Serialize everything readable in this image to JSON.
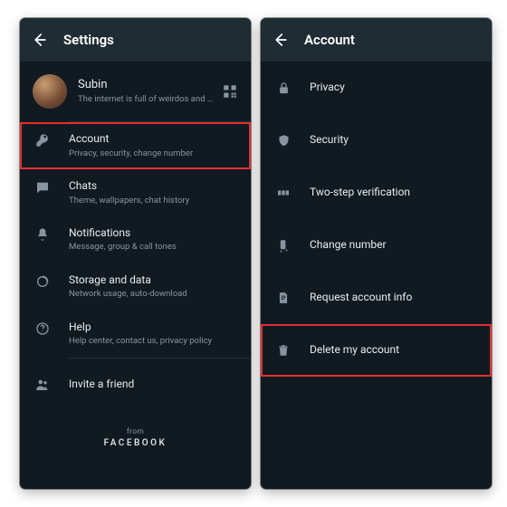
{
  "left": {
    "title": "Settings",
    "profile": {
      "name": "Subin",
      "status": "The internet is full of weirdos and nerd rage…"
    },
    "items": [
      {
        "title": "Account",
        "sub": "Privacy, security, change number",
        "highlight": true
      },
      {
        "title": "Chats",
        "sub": "Theme, wallpapers, chat history"
      },
      {
        "title": "Notifications",
        "sub": "Message, group & call tones"
      },
      {
        "title": "Storage and data",
        "sub": "Network usage, auto-download"
      },
      {
        "title": "Help",
        "sub": "Help center, contact us, privacy policy"
      },
      {
        "title": "Invite a friend"
      }
    ],
    "footer_from": "from",
    "footer_brand": "FACEBOOK"
  },
  "right": {
    "title": "Account",
    "items": [
      {
        "title": "Privacy"
      },
      {
        "title": "Security"
      },
      {
        "title": "Two-step verification"
      },
      {
        "title": "Change number"
      },
      {
        "title": "Request account info"
      },
      {
        "title": "Delete my account",
        "highlight": true
      }
    ]
  }
}
